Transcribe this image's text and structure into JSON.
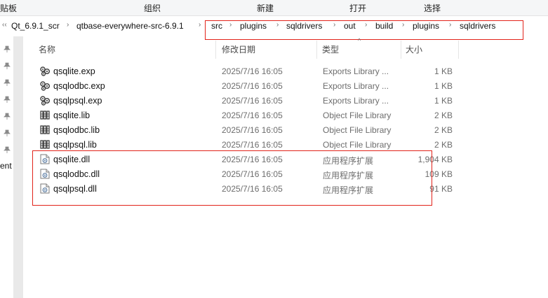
{
  "ribbon": {
    "clipboard_label": "贴板",
    "organize_label": "组织",
    "new_label": "新建",
    "open_label": "打开",
    "select_label": "选择"
  },
  "breadcrumb": {
    "items": [
      "Qt_6.9.1_scr",
      "qtbase-everywhere-src-6.9.1",
      "src",
      "plugins",
      "sqldrivers",
      "out",
      "build",
      "plugins",
      "sqldrivers"
    ],
    "highlight_color": "#e2231a"
  },
  "nav": {
    "truncated_text": "ent"
  },
  "columns": {
    "name": "名称",
    "date": "修改日期",
    "type": "类型",
    "size": "大小"
  },
  "files": [
    {
      "name": "qsqlite.exp",
      "date": "2025/7/16 16:05",
      "type": "Exports Library ...",
      "size": "1 KB",
      "icon": "exports-library-icon"
    },
    {
      "name": "qsqlodbc.exp",
      "date": "2025/7/16 16:05",
      "type": "Exports Library ...",
      "size": "1 KB",
      "icon": "exports-library-icon"
    },
    {
      "name": "qsqlpsql.exp",
      "date": "2025/7/16 16:05",
      "type": "Exports Library ...",
      "size": "1 KB",
      "icon": "exports-library-icon"
    },
    {
      "name": "qsqlite.lib",
      "date": "2025/7/16 16:05",
      "type": "Object File Library",
      "size": "2 KB",
      "icon": "object-library-icon"
    },
    {
      "name": "qsqlodbc.lib",
      "date": "2025/7/16 16:05",
      "type": "Object File Library",
      "size": "2 KB",
      "icon": "object-library-icon"
    },
    {
      "name": "qsqlpsql.lib",
      "date": "2025/7/16 16:05",
      "type": "Object File Library",
      "size": "2 KB",
      "icon": "object-library-icon"
    },
    {
      "name": "qsqlite.dll",
      "date": "2025/7/16 16:05",
      "type": "应用程序扩展",
      "size": "1,904 KB",
      "icon": "dll-file-icon"
    },
    {
      "name": "qsqlodbc.dll",
      "date": "2025/7/16 16:05",
      "type": "应用程序扩展",
      "size": "109 KB",
      "icon": "dll-file-icon"
    },
    {
      "name": "qsqlpsql.dll",
      "date": "2025/7/16 16:05",
      "type": "应用程序扩展",
      "size": "91 KB",
      "icon": "dll-file-icon"
    }
  ]
}
